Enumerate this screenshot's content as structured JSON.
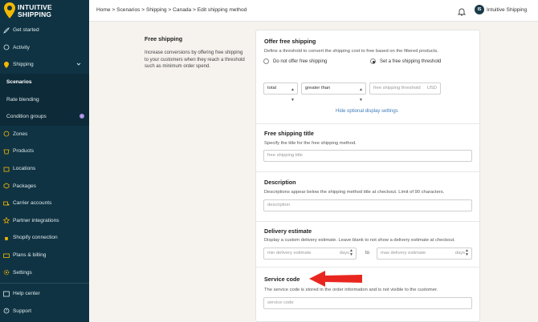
{
  "brand": {
    "line1": "INTUITIVE",
    "line2": "SHIPPING"
  },
  "sidebar": {
    "items": [
      {
        "label": "Get started",
        "icon": "rocket-icon"
      },
      {
        "label": "Activity",
        "icon": "activity-icon"
      },
      {
        "label": "Shipping",
        "icon": "shipping-icon"
      },
      {
        "label": "Scenarios"
      },
      {
        "label": "Rate blending"
      },
      {
        "label": "Condition groups",
        "badge": "i"
      },
      {
        "label": "Zones",
        "icon": "zones-icon"
      },
      {
        "label": "Products",
        "icon": "products-icon"
      },
      {
        "label": "Locations",
        "icon": "locations-icon"
      },
      {
        "label": "Packages",
        "icon": "packages-icon"
      },
      {
        "label": "Carrier accounts",
        "icon": "carrier-icon"
      },
      {
        "label": "Partner integrations",
        "icon": "partner-icon"
      },
      {
        "label": "Shopify connection",
        "icon": "shopify-icon"
      },
      {
        "label": "Plans & billing",
        "icon": "billing-icon"
      },
      {
        "label": "Settings",
        "icon": "gear-icon"
      },
      {
        "label": "Help center",
        "icon": "help-icon"
      },
      {
        "label": "Support",
        "icon": "support-icon"
      }
    ]
  },
  "topbar": {
    "breadcrumb": "Home > Scenarios > Shipping > Canada > Edit shipping method",
    "avatar": "IS",
    "shop_name": "Intuitive Shipping"
  },
  "intro": {
    "title": "Free shipping",
    "text": "Increase conversions by offering free shipping to your customers when they reach a threshold such as minimum order spend."
  },
  "offer": {
    "title": "Offer free shipping",
    "desc": "Define a threshold to convert the shipping cost to free based on the filtered products.",
    "radio_off": "Do not offer free shipping",
    "radio_on": "Set a free shipping threshold",
    "select_a": "total",
    "select_b": "greater than",
    "threshold_placeholder": "free shipping threshold",
    "threshold_unit": "USD",
    "link": "Hide optional display settings"
  },
  "title_sec": {
    "title": "Free shipping title",
    "desc": "Specify the title for the free shipping method.",
    "placeholder": "free shipping title"
  },
  "description_sec": {
    "title": "Description",
    "desc": "Descriptions appear below the shipping method title at checkout. Limit of 90 characters.",
    "placeholder": "description"
  },
  "delivery": {
    "title": "Delivery estimate",
    "desc": "Display a custom delivery estimate. Leave blank to not show a delivery estimate at checkout.",
    "min_placeholder": "min delivery estimate",
    "max_placeholder": "max delivery estimate",
    "unit": "days",
    "to": "to"
  },
  "service": {
    "title": "Service code",
    "desc": "The service code is stored in the order information and is not visible to the customer.",
    "placeholder": "service code"
  },
  "colors": {
    "sidebar": "#0f3343",
    "accent": "#f5b800",
    "arrow": "#e8261f",
    "link": "#3c7bb8"
  }
}
